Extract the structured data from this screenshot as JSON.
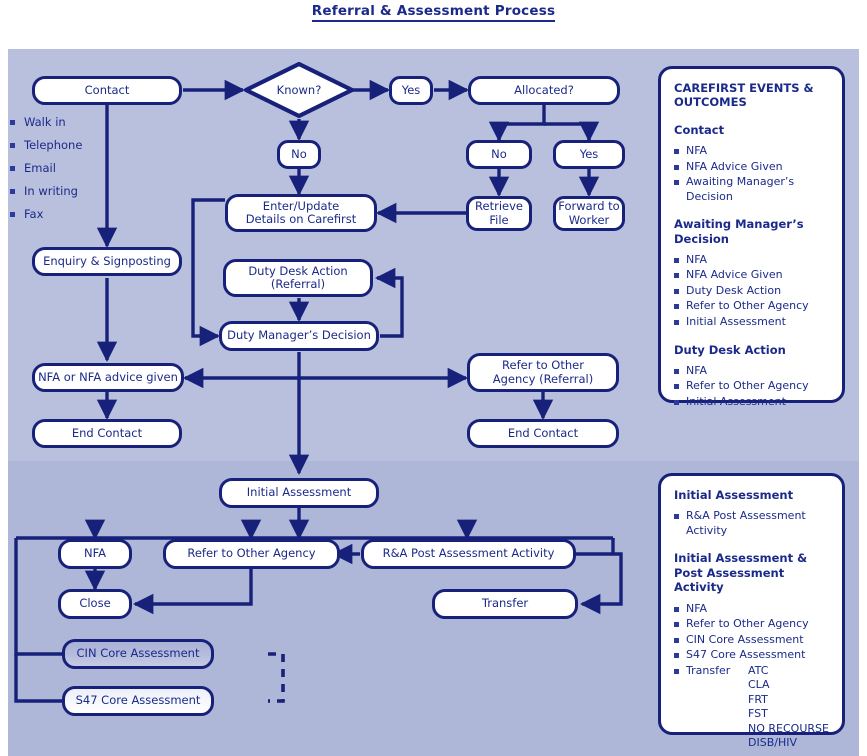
{
  "page": {
    "title": "Referral & Assessment Process",
    "accent": "#17217a",
    "text_color": "#1b2a8a",
    "band_top_color": "#b9c0dd",
    "band_bottom_color": "#aeb7d8"
  },
  "contact_sources": [
    {
      "label": "Walk in"
    },
    {
      "label": "Telephone"
    },
    {
      "label": "Email"
    },
    {
      "label": "In writing"
    },
    {
      "label": "Fax"
    }
  ],
  "nodes": {
    "contact": "Contact",
    "known": "Known?",
    "yes_known": "Yes",
    "allocated": "Allocated?",
    "no_known": "No",
    "no_allocated": "No",
    "yes_allocated": "Yes",
    "retrieve_file": "Retrieve\nFile",
    "forward_worker": "Forward to\nWorker",
    "enter_update": "Enter/Update\nDetails on Carefirst",
    "enquiry": "Enquiry & Signposting",
    "duty_desk": "Duty Desk Action\n(Referral)",
    "duty_manager": "Duty Manager’s Decision",
    "nfa_advice": "NFA or NFA advice given",
    "refer_other_referral": "Refer to Other\nAgency (Referral)",
    "end_contact_left": "End Contact",
    "end_contact_right": "End Contact",
    "initial_assessment": "Initial Assessment",
    "nfa": "NFA",
    "refer_other_agency": "Refer to Other Agency",
    "ra_post": "R&A Post Assessment Activity",
    "close": "Close",
    "transfer": "Transfer",
    "cin_core": "CIN Core Assessment",
    "s47_core": "S47 Core Assessment"
  },
  "panel_top": {
    "heading": "CAREFIRST EVENTS & OUTCOMES",
    "sections": [
      {
        "heading": "Contact",
        "items": [
          "NFA",
          "NFA Advice Given",
          "Awaiting Manager’s Decision"
        ]
      },
      {
        "heading": "Awaiting Manager’s Decision",
        "items": [
          "NFA",
          "NFA Advice Given",
          "Duty Desk Action",
          "Refer to Other Agency",
          "Initial Assessment"
        ]
      },
      {
        "heading": "Duty Desk Action",
        "items": [
          "NFA",
          "Refer to Other Agency",
          "Initial Assessment"
        ]
      }
    ]
  },
  "panel_bottom": {
    "sections": [
      {
        "heading": "Initial Assessment",
        "items": [
          "R&A Post Assessment Activity"
        ]
      },
      {
        "heading": "Initial Assessment & Post Assessment Activity",
        "items": [
          "NFA",
          "Refer to Other Agency",
          "CIN Core Assessment",
          "S47 Core Assessment"
        ],
        "transfer_label": "Transfer",
        "transfer_options": [
          "ATC",
          "CLA",
          "FRT",
          "FST",
          "NO RECOURSE",
          "DISB/HIV"
        ]
      }
    ]
  }
}
